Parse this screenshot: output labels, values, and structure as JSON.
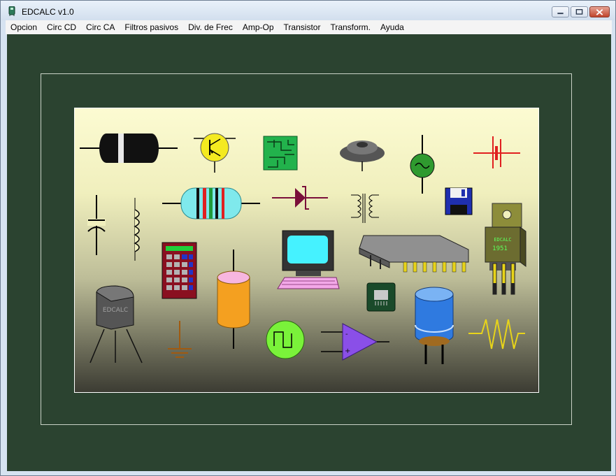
{
  "window": {
    "title": "EDCALC v1.0"
  },
  "menu": {
    "items": [
      {
        "id": "opcion",
        "label": "Opcion"
      },
      {
        "id": "circ-cd",
        "label": "Circ CD"
      },
      {
        "id": "circ-ca",
        "label": "Circ CA"
      },
      {
        "id": "filtros-pasivos",
        "label": "Filtros pasivos"
      },
      {
        "id": "div-de-frec",
        "label": "Div. de Frec"
      },
      {
        "id": "amp-op",
        "label": "Amp-Op"
      },
      {
        "id": "transistor",
        "label": "Transistor"
      },
      {
        "id": "transform",
        "label": "Transform."
      },
      {
        "id": "ayuda",
        "label": "Ayuda"
      }
    ]
  },
  "illustration": {
    "speaker_label": "EDCALC",
    "regulator_brand": "EDCALC",
    "regulator_code": "1951"
  },
  "colors": {
    "client_background": "#2b4330",
    "frame_line": "#c9d2c6"
  }
}
